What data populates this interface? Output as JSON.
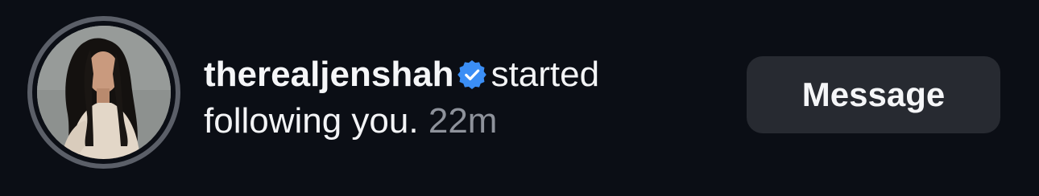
{
  "notification": {
    "username": "therealjenshah",
    "action_text": "started following you.",
    "time": "22m",
    "verified_icon": "verified-badge-icon",
    "avatar_icon": "profile-avatar"
  },
  "actions": {
    "message_label": "Message"
  },
  "colors": {
    "background": "#0b0e15",
    "button_bg": "#272a31",
    "verified_blue": "#3b8ef5",
    "secondary_text": "#8e929b",
    "avatar_ring": "#5b5f68"
  }
}
